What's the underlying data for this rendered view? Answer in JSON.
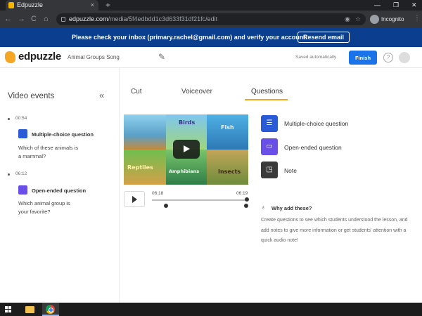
{
  "browser": {
    "tab_title": "Edpuzzle",
    "tab_close": "×",
    "new_tab": "+",
    "window_controls": [
      "—",
      "❐",
      "✕"
    ],
    "nav": {
      "back": "←",
      "forward": "→",
      "reload": "C",
      "home": "⌂"
    },
    "url_host": "edpuzzle.com",
    "url_path": "/media/5f4edbdd1c3d633f31df21fc/edit",
    "incognito_label": "Incognito",
    "menu": "⋮"
  },
  "banner": {
    "message": "Please check your inbox (primary.rachel@gmail.com) and verify your account.",
    "resend_label": "Resend email"
  },
  "header": {
    "logo_text": "edpuzzle",
    "project_title": "Animal Groups Song",
    "saved_status": "Saved automatically",
    "finish_label": "Finish",
    "help_label": "?"
  },
  "left_panel": {
    "title": "Video events",
    "collapse_label": "«",
    "events": [
      {
        "time": "00:54",
        "type": "Multiple-choice question",
        "text": "Which of these animals is a mammal?"
      },
      {
        "time": "06:12",
        "type": "Open-ended question",
        "text": "Which animal group is your favorite?"
      }
    ]
  },
  "editor": {
    "tabs": [
      "Cut",
      "Voiceover",
      "Questions"
    ],
    "active_tab": "Questions",
    "video_labels": [
      "Birds",
      "Fish",
      "Reptiles",
      "Amphibians",
      "Insects"
    ],
    "time_start": "06:18",
    "time_end": "06:19",
    "progress": 0.99
  },
  "options": {
    "items": [
      {
        "label": "Multiple-choice question",
        "icon": "list-icon"
      },
      {
        "label": "Open-ended question",
        "icon": "chat-icon"
      },
      {
        "label": "Note",
        "icon": "note-icon"
      }
    ],
    "why_title": "Why add these?",
    "why_text": "Create questions to see which students understood the lesson, and add notes to give more information or get students' attention with a quick audio note!"
  },
  "colors": {
    "banner_bg": "#0b3e8f",
    "finish_bg": "#1a73e8",
    "tab_accent": "#f5a623",
    "mc_icon": "#2a5bd7",
    "oe_icon": "#6a4ee8",
    "note_icon": "#3a3a3a"
  }
}
